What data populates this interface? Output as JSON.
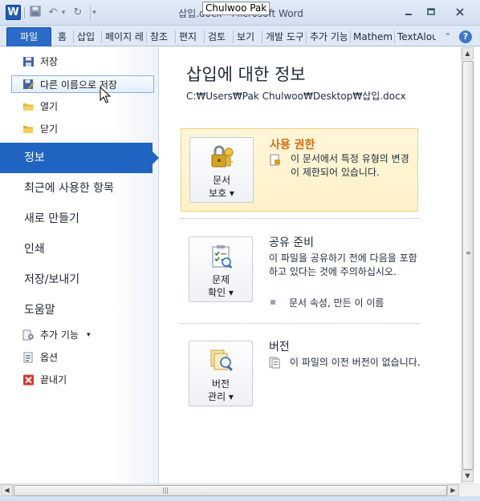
{
  "window": {
    "app_icon": "W",
    "title": "삽입.docx - Microsoft Word",
    "tooltip_author": "Chulwoo Pak",
    "controls": {
      "minimize": "—",
      "maximize": "□",
      "close": "✕"
    }
  },
  "quick_access": {
    "save_icon": "floppy-disk",
    "undo_glyph": "↶",
    "redo_glyph": "↻",
    "customize_glyph": "▾"
  },
  "ribbon": {
    "file_tab": "파일",
    "tabs": [
      "홈",
      "삽입",
      "페이지 레",
      "참조",
      "편지",
      "검토",
      "보기",
      "개발 도구",
      "추가 기능",
      "Mathem",
      "TextAlou"
    ],
    "collapse_glyph": "⌃",
    "help_glyph": "?"
  },
  "nav": {
    "save": "저장",
    "save_as": "다른 이름으로 저장",
    "open": "열기",
    "close": "닫기",
    "info": "정보",
    "recent": "최근에 사용한 항목",
    "new": "새로 만들기",
    "print": "인쇄",
    "save_send": "저장/보내기",
    "help": "도움말",
    "addins": "추가 기능",
    "addins_arrow": "▾",
    "options": "옵션",
    "exit": "끝내기"
  },
  "main": {
    "title": "삽입에 대한 정보",
    "path": "C:₩Users₩Pak Chulwoo₩Desktop₩삽입.docx",
    "permissions": {
      "button_line1": "문서",
      "button_line2": "보호 ▾",
      "title": "사용 권한",
      "desc": "이 문서에서 특정 유형의 변경이 제한되어 있습니다."
    },
    "prepare": {
      "button_line1": "문제",
      "button_line2": "확인 ▾",
      "title": "공유 준비",
      "desc": "이 파일을 공유하기 전에 다음을 포함하고 있다는 것에 주의하십시오.",
      "bullet": "문서 속성, 만든 이 이름"
    },
    "versions": {
      "button_line1": "버전",
      "button_line2": "관리 ▾",
      "title": "버전",
      "desc": "이 파일의 이전 버전이 없습니다."
    }
  },
  "scrollbars": {
    "up": "▲",
    "down": "▼",
    "left": "◀",
    "right": "▶",
    "grip_v": "≡",
    "grip_h": "|||"
  }
}
